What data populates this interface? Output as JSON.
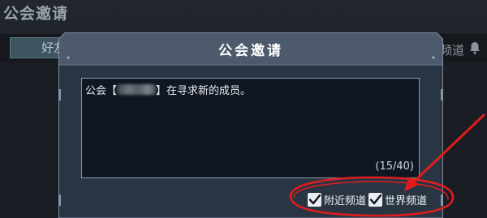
{
  "background": {
    "screen_title": "公会邀请",
    "tab_friends": "好友",
    "tab_channel": "频道",
    "bell_icon": "bell-icon"
  },
  "dialog": {
    "title": "公会邀请",
    "message": {
      "prefix": "公会【",
      "suffix": "】在寻求新的成员。"
    },
    "char_counter": "(15/40)",
    "options": [
      {
        "label": "附近频道",
        "checked": true,
        "icon": "check-icon"
      },
      {
        "label": "世界频道",
        "checked": true,
        "icon": "check-icon"
      }
    ]
  },
  "annotation": {
    "color": "#e21c1c"
  }
}
